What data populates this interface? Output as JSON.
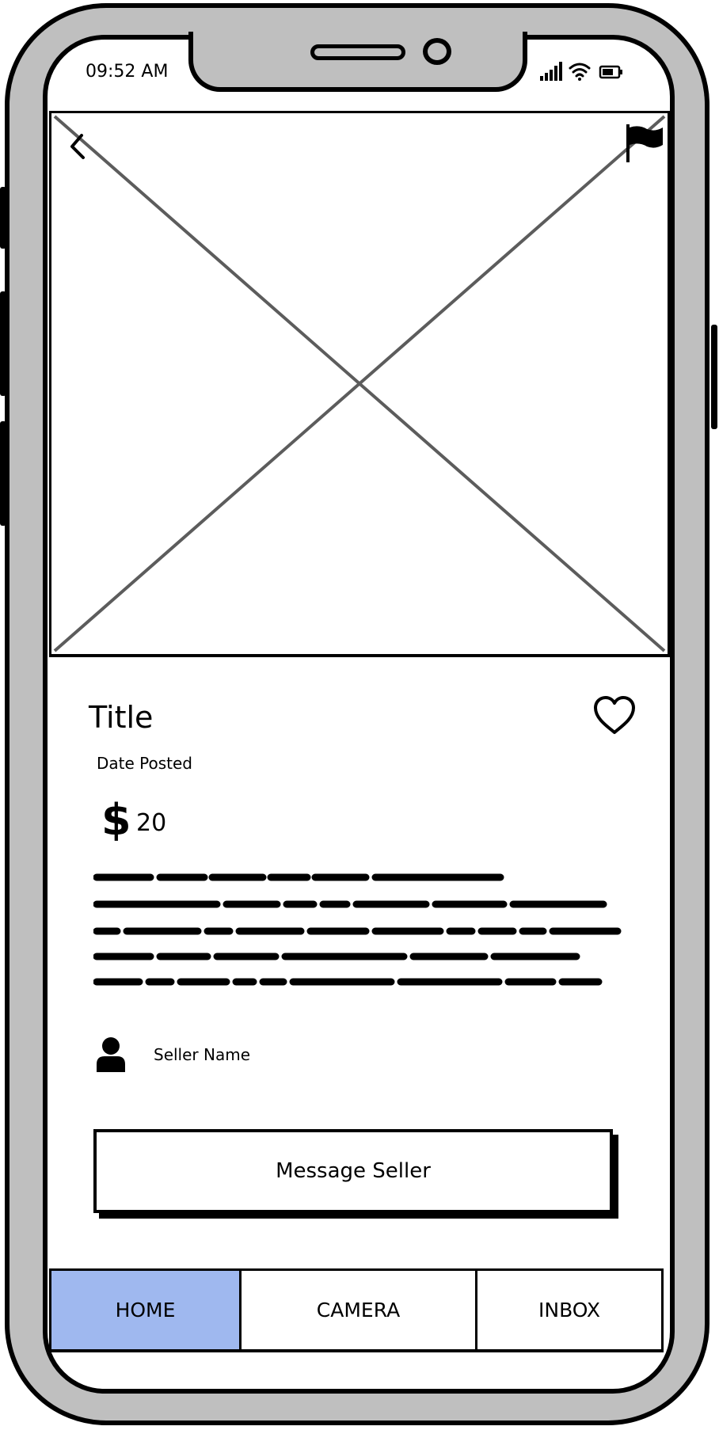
{
  "status_bar": {
    "time": "09:52 AM",
    "icons": [
      "signal-icon",
      "wifi-icon",
      "battery-icon"
    ]
  },
  "hero": {
    "placeholder": "image-placeholder",
    "back_icon": "chevron-left-icon",
    "report_icon": "flag-icon"
  },
  "listing": {
    "title": "Title",
    "date_posted": "Date Posted",
    "currency_symbol": "$",
    "price": "20",
    "favorite_icon": "heart-outline-icon",
    "description_lines": 5
  },
  "seller": {
    "icon": "user-icon",
    "name": "Seller Name"
  },
  "actions": {
    "message_label": "Message Seller"
  },
  "tabbar": {
    "tabs": [
      {
        "label": "HOME",
        "active": true
      },
      {
        "label": "CAMERA",
        "active": false
      },
      {
        "label": "INBOX",
        "active": false
      }
    ]
  },
  "colors": {
    "frame": "#bfbfbf",
    "active_tab": "#9fb8ef",
    "placeholder_lines": "#5c5c5c"
  }
}
